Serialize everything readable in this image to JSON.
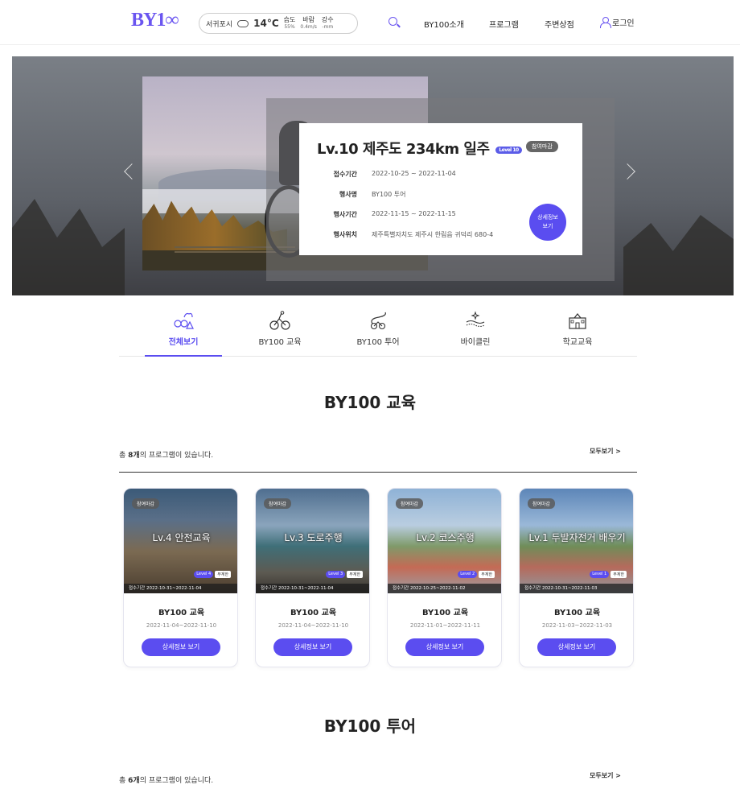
{
  "header": {
    "logo": "BY1∞",
    "weather": {
      "city": "서귀포시",
      "temp": "14°C",
      "humidity_label": "습도",
      "humidity_value": "55%",
      "wind_label": "바람",
      "wind_value": "0.4m/s",
      "rain_label": "강수",
      "rain_value": "-mm"
    },
    "nav": [
      "BY100소개",
      "프로그램",
      "주변상점"
    ],
    "login": "로그인"
  },
  "hero": {
    "title": "Lv.10 제주도 234km 일주",
    "level_badge": "Level 10",
    "status_badge": "참여마감",
    "rows": [
      {
        "k": "접수기간",
        "v": "2022-10-25 ~ 2022-11-04"
      },
      {
        "k": "행사명",
        "v": "BY100 투어"
      },
      {
        "k": "행사기간",
        "v": "2022-11-15 ~ 2022-11-15"
      },
      {
        "k": "행사위치",
        "v": "제주특별자치도 제주시 한림읍 귀덕리 680-4"
      }
    ],
    "detail_button": "상세정보\n보기"
  },
  "tabs": [
    "전체보기",
    "BY100 교육",
    "BY100 투어",
    "바이클린",
    "학교교육"
  ],
  "sections": [
    {
      "title": "BY100 교육",
      "count_prefix": "총 ",
      "count_number": "8개",
      "count_suffix": "의 프로그램이 있습니다.",
      "more": "모두보기 >",
      "cards": [
        {
          "status": "참여마감",
          "image_title": "Lv.4 안전교육",
          "level": "Level 4",
          "free": "무계한",
          "reg": "접수기간 2022-10-31~2022-11-04",
          "name": "BY100 교육",
          "range": "2022-11-04~2022-11-10",
          "button": "상세정보 보기"
        },
        {
          "status": "참여마감",
          "image_title": "Lv.3 도로주행",
          "level": "Level 3",
          "free": "무계한",
          "reg": "접수기간 2022-10-31~2022-11-04",
          "name": "BY100 교육",
          "range": "2022-11-04~2022-11-10",
          "button": "상세정보 보기"
        },
        {
          "status": "참여마감",
          "image_title": "Lv.2 코스주행",
          "level": "Level 2",
          "free": "무계한",
          "reg": "접수기간 2022-10-25~2022-11-02",
          "name": "BY100 교육",
          "range": "2022-11-01~2022-11-11",
          "button": "상세정보 보기"
        },
        {
          "status": "참여마감",
          "image_title": "Lv.1 두발자전거 배우기",
          "level": "Level 1",
          "free": "무계한",
          "reg": "접수기간 2022-10-31~2022-11-03",
          "name": "BY100 교육",
          "range": "2022-11-03~2022-11-03",
          "button": "상세정보 보기"
        }
      ]
    },
    {
      "title": "BY100 투어",
      "count_prefix": "총 ",
      "count_number": "6개",
      "count_suffix": "의 프로그램이 있습니다.",
      "more": "모두보기 >"
    }
  ],
  "colors": {
    "accent": "#5b4df0",
    "logo": "#6a55f0"
  }
}
